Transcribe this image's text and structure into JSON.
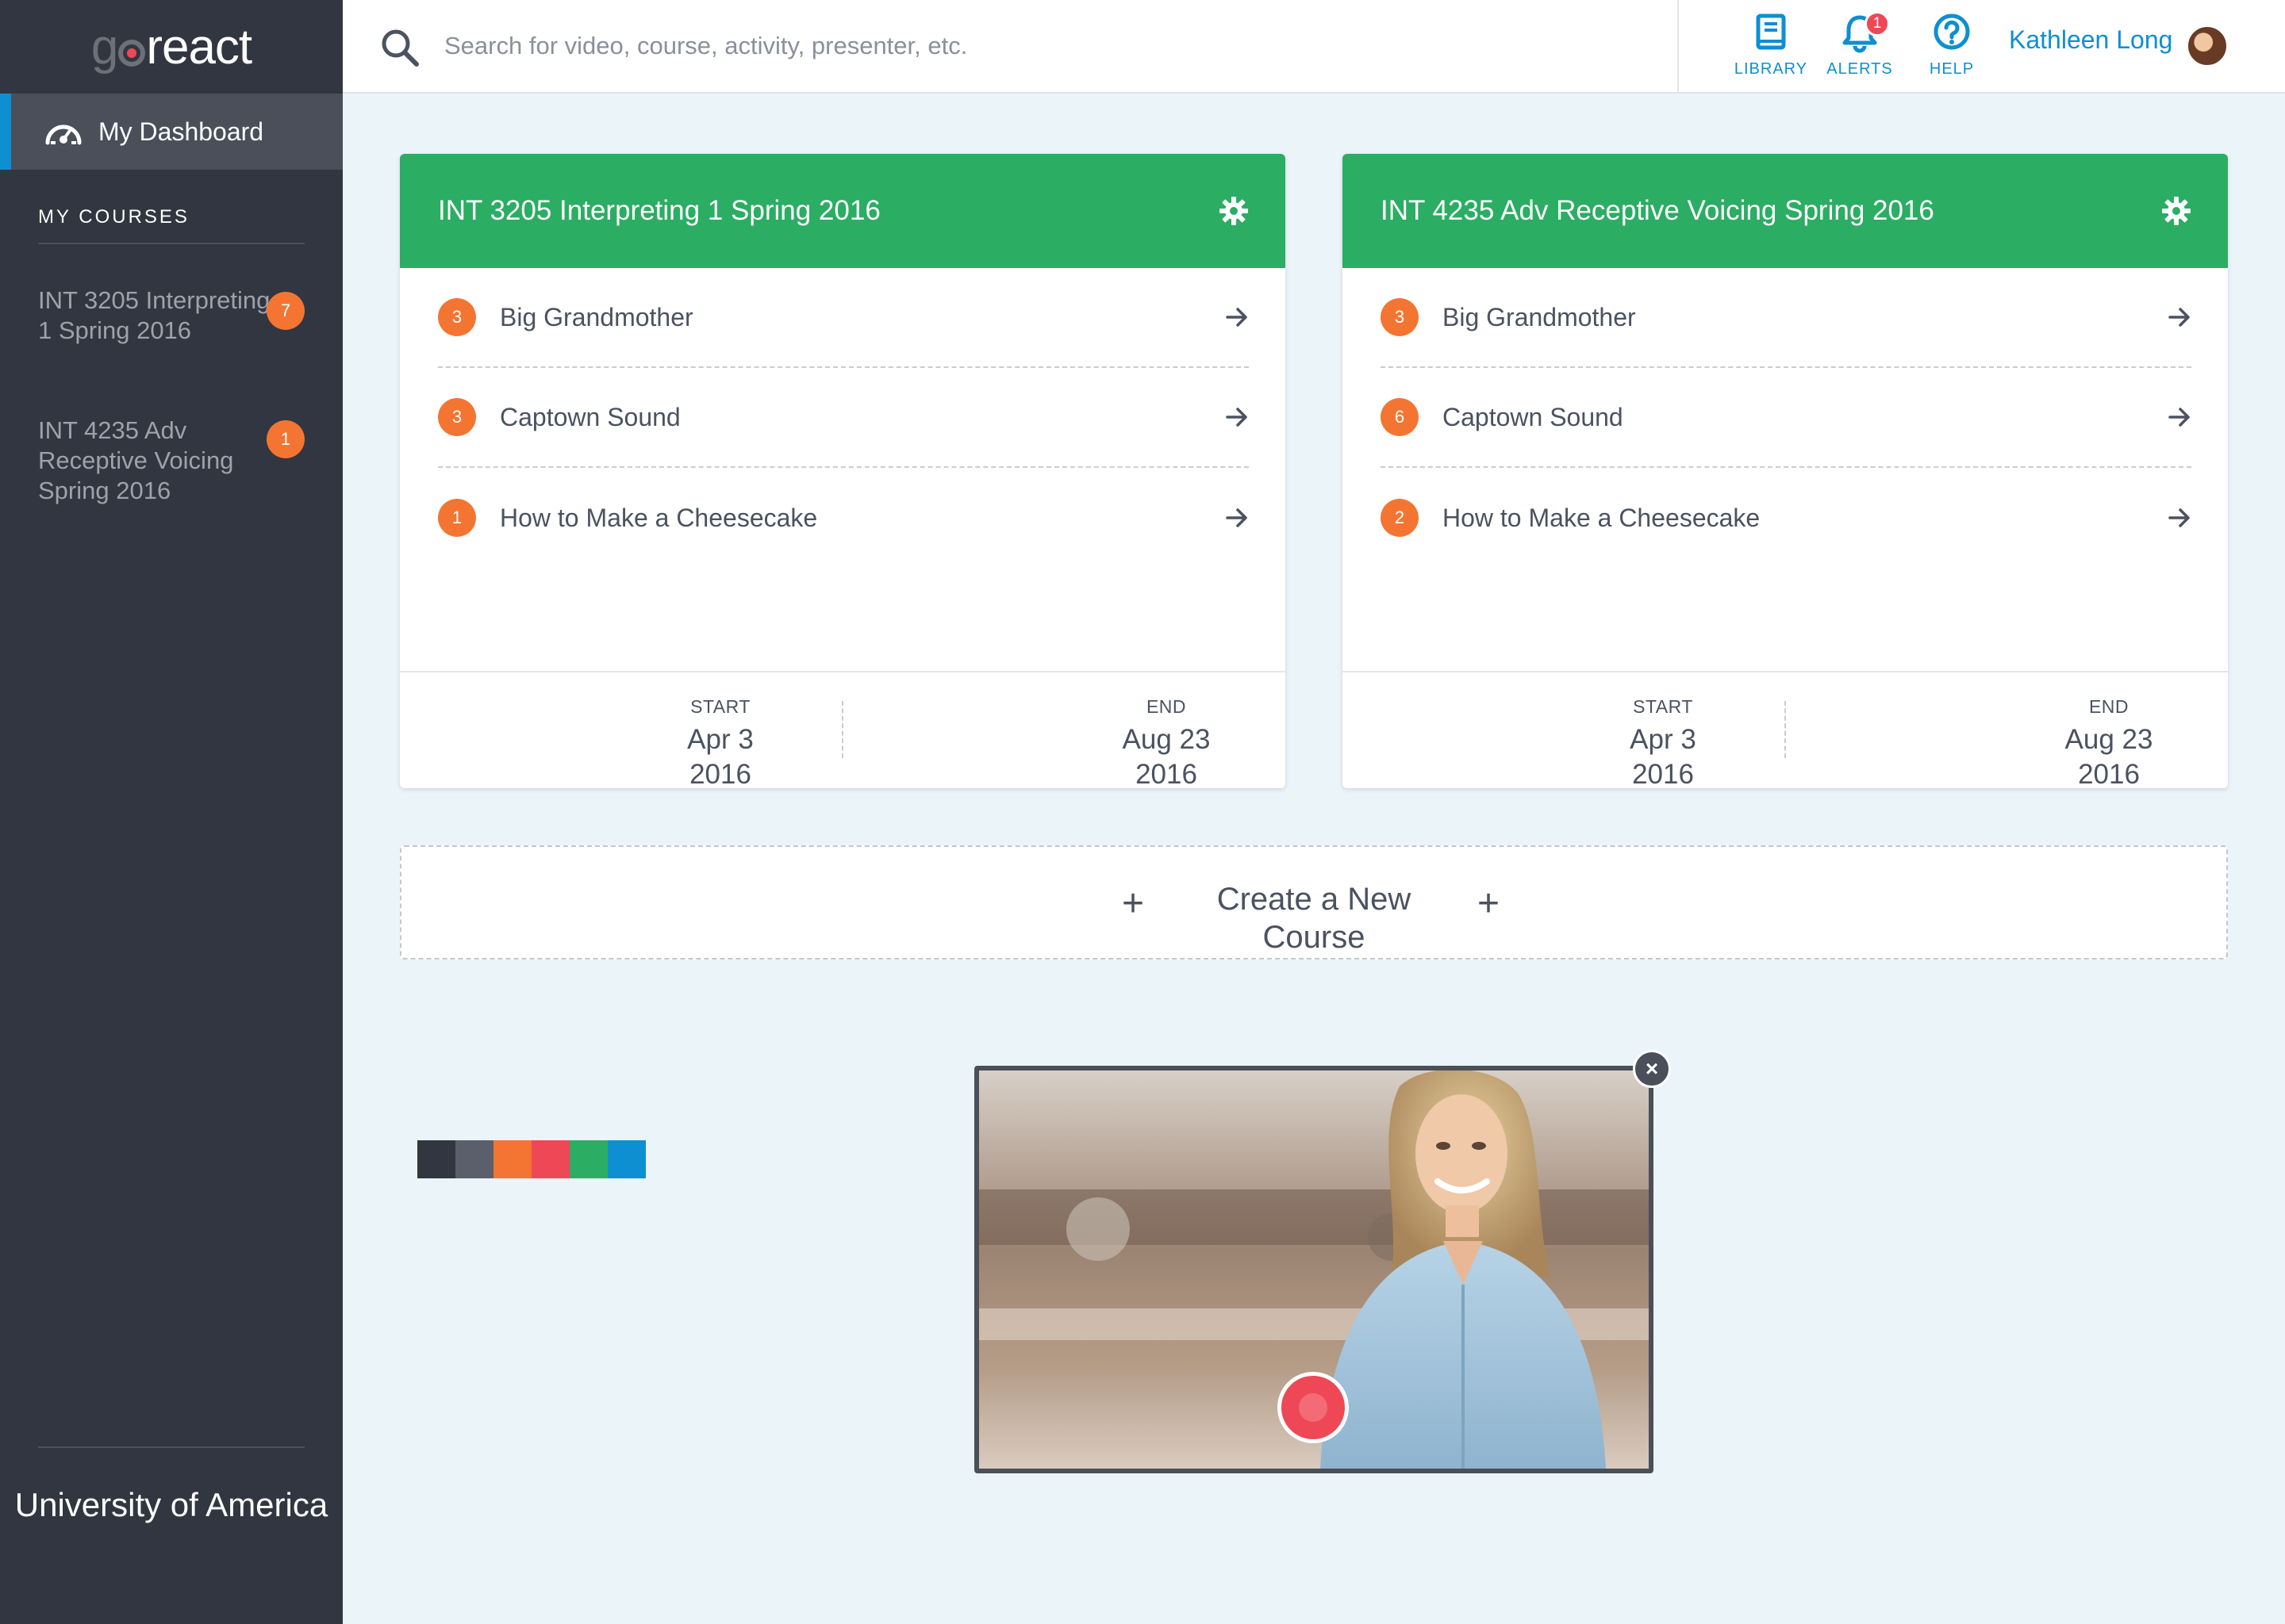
{
  "app": {
    "logo_go": "go",
    "logo_react": "react"
  },
  "sidebar": {
    "dashboard_label": "My Dashboard",
    "courses_heading": "MY COURSES",
    "courses": [
      {
        "name": "INT 3205 Interpreting 1 Spring 2016",
        "badge": "7"
      },
      {
        "name": "INT 4235 Adv Receptive Voicing Spring 2016",
        "badge": "1"
      }
    ],
    "university": "University of America"
  },
  "topbar": {
    "search_placeholder": "Search for video, course, activity, presenter, etc.",
    "library_label": "LIBRARY",
    "alerts_label": "ALERTS",
    "alerts_count": "1",
    "help_label": "HELP",
    "user_name": "Kathleen Long"
  },
  "cards": [
    {
      "title": "INT 3205 Interpreting 1 Spring 2016",
      "activities": [
        {
          "count": "3",
          "title": "Big Grandmother"
        },
        {
          "count": "3",
          "title": "Captown Sound"
        },
        {
          "count": "1",
          "title": "How to Make a Cheesecake"
        }
      ],
      "start_label": "START",
      "start_date": "Apr 3",
      "start_year": "2016",
      "end_label": "END",
      "end_date": "Aug 23",
      "end_year": "2016"
    },
    {
      "title": "INT 4235 Adv Receptive Voicing Spring 2016",
      "activities": [
        {
          "count": "3",
          "title": "Big Grandmother"
        },
        {
          "count": "6",
          "title": "Captown Sound"
        },
        {
          "count": "2",
          "title": "How to Make a Cheesecake"
        }
      ],
      "start_label": "START",
      "start_date": "Apr 3",
      "start_year": "2016",
      "end_label": "END",
      "end_date": "Aug 23",
      "end_year": "2016"
    }
  ],
  "create_course": {
    "label": "Create a New Course",
    "plus": "+"
  },
  "palette": [
    "#323640",
    "#5a5f6b",
    "#f47532",
    "#ee4856",
    "#2bad63",
    "#0d8fd1"
  ],
  "colors": {
    "sidebar_bg": "#323640",
    "accent_green": "#2bad63",
    "accent_blue": "#0d8fd1",
    "badge_orange": "#f47532",
    "alert_red": "#ee4856"
  },
  "video": {
    "close_symbol": "×"
  }
}
